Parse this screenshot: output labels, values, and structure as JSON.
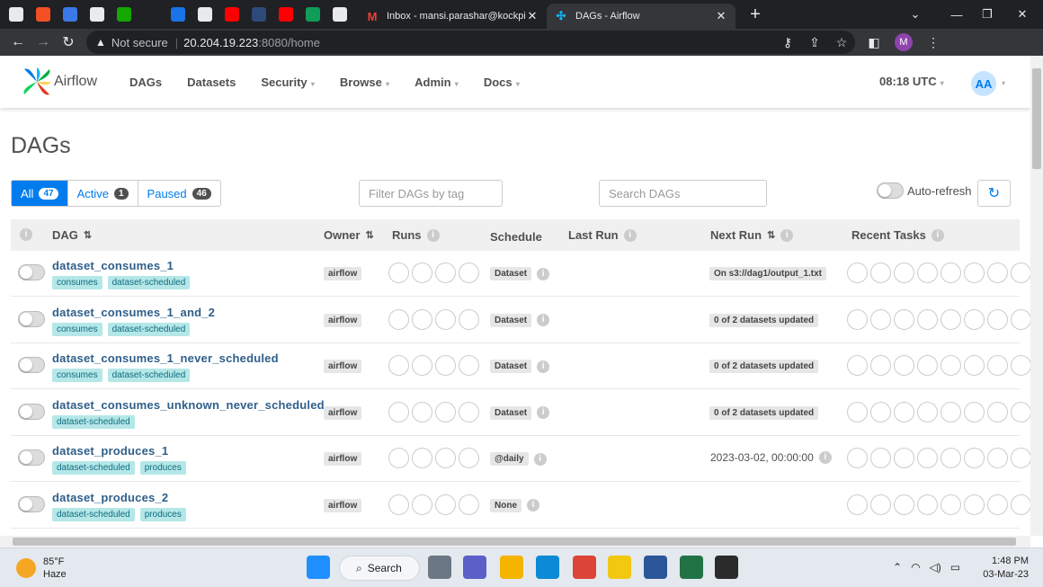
{
  "browser": {
    "pinned_tabs": [
      {
        "name": "file-icon",
        "color": "#e8eaed"
      },
      {
        "name": "microsoft-icon",
        "color": "#f25022"
      },
      {
        "name": "app-icon",
        "color": "#3b78e7"
      },
      {
        "name": "github-icon",
        "color": "#e8eaed"
      },
      {
        "name": "upwork-icon",
        "color": "#14a800"
      },
      {
        "name": "app-icon",
        "color": "#202124"
      },
      {
        "name": "app-icon",
        "color": "#1a73e8"
      },
      {
        "name": "github-icon",
        "color": "#e8eaed"
      },
      {
        "name": "youtube-icon",
        "color": "#ff0000"
      },
      {
        "name": "app-icon",
        "color": "#2d4a7a"
      },
      {
        "name": "youtube-icon",
        "color": "#ff0000"
      },
      {
        "name": "sheets-icon",
        "color": "#0f9d58"
      },
      {
        "name": "medium-icon",
        "color": "#e8eaed"
      }
    ],
    "tabs": [
      {
        "title": "Inbox - mansi.parashar@kockpit.",
        "icon": "gmail-icon",
        "active": false
      },
      {
        "title": "DAGs - Airflow",
        "icon": "airflow-icon",
        "active": true
      }
    ],
    "new_tab": "+",
    "address": {
      "security": "Not secure",
      "host": "20.204.19.223",
      "rest": ":8080/home"
    },
    "profile": "M"
  },
  "nav": {
    "brand": "Airflow",
    "items": [
      {
        "label": "DAGs",
        "dropdown": false
      },
      {
        "label": "Datasets",
        "dropdown": false
      },
      {
        "label": "Security",
        "dropdown": true
      },
      {
        "label": "Browse",
        "dropdown": true
      },
      {
        "label": "Admin",
        "dropdown": true
      },
      {
        "label": "Docs",
        "dropdown": true
      }
    ],
    "clock": "08:18 UTC",
    "avatar": "AA"
  },
  "page_title": "DAGs",
  "filters": [
    {
      "label": "All",
      "count": "47",
      "selected": true
    },
    {
      "label": "Active",
      "count": "1",
      "selected": false
    },
    {
      "label": "Paused",
      "count": "46",
      "selected": false
    }
  ],
  "tag_filter": {
    "placeholder": "Filter DAGs by tag"
  },
  "search": {
    "placeholder": "Search DAGs"
  },
  "auto_refresh": "Auto-refresh",
  "columns": {
    "dag": "DAG",
    "owner": "Owner",
    "runs": "Runs",
    "schedule": "Schedule",
    "last_run": "Last Run",
    "next_run": "Next Run",
    "recent_tasks": "Recent Tasks"
  },
  "dags": [
    {
      "id": "dataset_consumes_1",
      "tags": [
        "consumes",
        "dataset-scheduled"
      ],
      "owner": "airflow",
      "schedule": "Dataset",
      "next_run": "On s3://dag1/output_1.txt",
      "next_badge": true
    },
    {
      "id": "dataset_consumes_1_and_2",
      "tags": [
        "consumes",
        "dataset-scheduled"
      ],
      "owner": "airflow",
      "schedule": "Dataset",
      "next_run": "0 of 2 datasets updated",
      "next_badge": true
    },
    {
      "id": "dataset_consumes_1_never_scheduled",
      "tags": [
        "consumes",
        "dataset-scheduled"
      ],
      "owner": "airflow",
      "schedule": "Dataset",
      "next_run": "0 of 2 datasets updated",
      "next_badge": true
    },
    {
      "id": "dataset_consumes_unknown_never_scheduled",
      "tags": [
        "dataset-scheduled"
      ],
      "owner": "airflow",
      "schedule": "Dataset",
      "next_run": "0 of 2 datasets updated",
      "next_badge": true
    },
    {
      "id": "dataset_produces_1",
      "tags": [
        "dataset-scheduled",
        "produces"
      ],
      "owner": "airflow",
      "schedule": "@daily",
      "next_run": "2023-03-02, 00:00:00",
      "next_badge": false
    },
    {
      "id": "dataset_produces_2",
      "tags": [
        "dataset-scheduled",
        "produces"
      ],
      "owner": "airflow",
      "schedule": "None",
      "next_run": "",
      "next_badge": false
    }
  ],
  "taskbar": {
    "temp": "85°F",
    "condition": "Haze",
    "search": "Search",
    "apps": [
      {
        "name": "windows-start-icon",
        "color": "#1f8fff"
      },
      {
        "name": "task-view-icon",
        "color": "#6b7785"
      },
      {
        "name": "meet-icon",
        "color": "#5b5fc7"
      },
      {
        "name": "file-explorer-icon",
        "color": "#f4b400"
      },
      {
        "name": "edge-icon",
        "color": "#0c8ad6"
      },
      {
        "name": "chrome-icon",
        "color": "#db4437"
      },
      {
        "name": "power-bi-icon",
        "color": "#f2c811"
      },
      {
        "name": "word-icon",
        "color": "#2b579a"
      },
      {
        "name": "excel-icon",
        "color": "#217346"
      },
      {
        "name": "terminal-icon",
        "color": "#2b2b2b"
      }
    ],
    "time": "1:48 PM",
    "date": "03-Mar-23"
  }
}
